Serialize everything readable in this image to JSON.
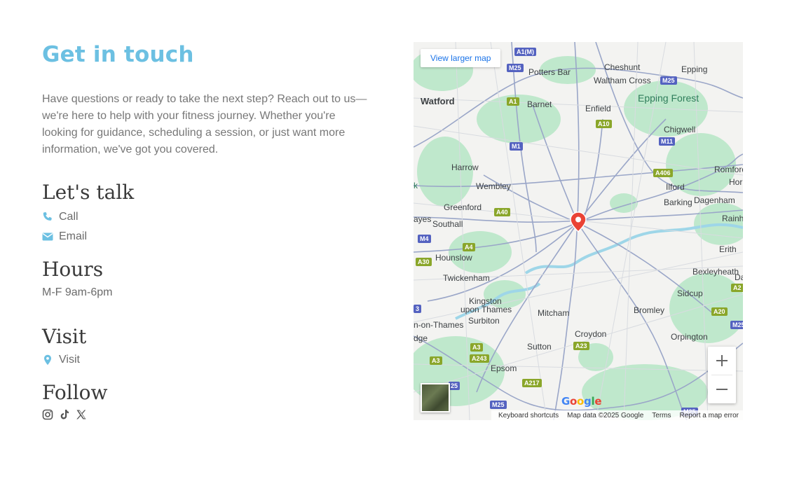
{
  "contact": {
    "title": "Get in touch",
    "intro": "Have questions or ready to take the next step? Reach out to us—we're here to help with your fitness journey. Whether you're looking for guidance, scheduling a session, or just want more information, we've got you covered.",
    "lets_talk": {
      "heading": "Let's talk",
      "call_label": "Call",
      "email_label": "Email"
    },
    "hours": {
      "heading": "Hours",
      "text": "M-F 9am-6pm"
    },
    "visit": {
      "heading": "Visit",
      "label": "Visit"
    },
    "follow": {
      "heading": "Follow",
      "icons": [
        "instagram-icon",
        "tiktok-icon",
        "x-icon"
      ]
    }
  },
  "map": {
    "view_larger": "View larger map",
    "places": {
      "watford": "Watford",
      "potters_bar": "Potters Bar",
      "cheshunt": "Cheshunt",
      "epping": "Epping",
      "waltham_cross": "Waltham Cross",
      "epping_forest": "Epping Forest",
      "barnet": "Barnet",
      "enfield": "Enfield",
      "chigwell": "Chigwell",
      "harrow": "Harrow",
      "romford": "Romford",
      "wembley": "Wembley",
      "ilford": "Ilford",
      "hor": "Hor",
      "greenford": "Greenford",
      "barking": "Barking",
      "dagenham": "Dagenham",
      "ayes": "ayes",
      "southall": "Southall",
      "rainh": "Rainh",
      "erith": "Erith",
      "hounslow": "Hounslow",
      "bexleyheath": "Bexleyheath",
      "twickenham": "Twickenham",
      "da": "Da",
      "sidcup": "Sidcup",
      "kingston": "Kingston",
      "upon_thames": "upon Thames",
      "mitcham": "Mitcham",
      "bromley": "Bromley",
      "on_thames": "n-on-Thames",
      "surbiton": "Surbiton",
      "croydon": "Croydon",
      "orpington": "Orpington",
      "dge": "dge",
      "sutton": "Sutton",
      "epsom": "Epsom",
      "k": "k"
    },
    "roads": {
      "a1m": "A1(M)",
      "m25a": "M25",
      "m25b": "M25",
      "a1": "A1",
      "a10": "A10",
      "m1": "M1",
      "m11": "M11",
      "a406": "A406",
      "a40": "A40",
      "m4": "M4",
      "a4": "A4",
      "a30": "A30",
      "a2": "A2",
      "a20": "A20",
      "m25c": "M25",
      "r3": "3",
      "a3a": "A3",
      "a23": "A23",
      "a243": "A243",
      "a3b": "A3",
      "a217": "A217",
      "m25d": "M25",
      "m25e": "M25",
      "r25": "25",
      "r4": "4"
    },
    "zoom_in": "+",
    "zoom_out": "−",
    "google": [
      "G",
      "o",
      "o",
      "g",
      "l",
      "e"
    ],
    "footer": {
      "shortcuts": "Keyboard shortcuts",
      "data": "Map data ©2025 Google",
      "terms": "Terms",
      "report": "Report a map error"
    }
  },
  "colors": {
    "accent": "#6cc0e2",
    "heading": "#3a3a3a",
    "pin": "#ea4335",
    "map_green": "#b7e6c4",
    "map_water": "#9ed6e8"
  }
}
